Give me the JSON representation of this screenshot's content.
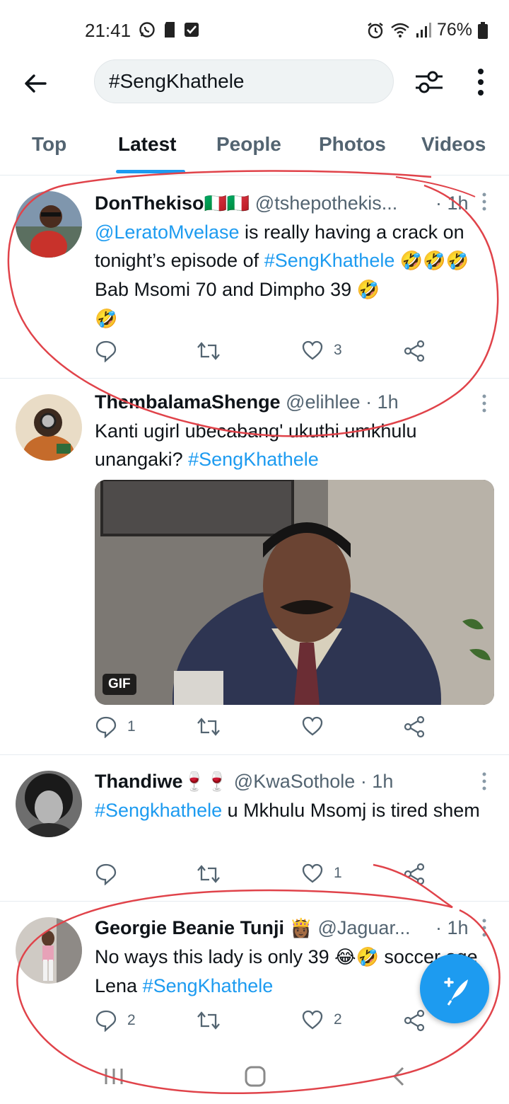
{
  "status_bar": {
    "time": "21:41",
    "battery": "76%"
  },
  "search": {
    "query": "#SengKhathele"
  },
  "tabs": [
    {
      "label": "Top"
    },
    {
      "label": "Latest",
      "active": true
    },
    {
      "label": "People"
    },
    {
      "label": "Photos"
    },
    {
      "label": "Videos"
    }
  ],
  "tweets": [
    {
      "name": "DonThekiso",
      "name_emoji": "🇮🇹🇮🇹",
      "handle": "@tshepothekis...",
      "time": "· 1h",
      "mention": "@LeratoMvelase",
      "text1": " is really having a crack on tonight’s episode of ",
      "hashtag": "#SengKhathele",
      "emoji1": "🤣🤣🤣",
      "text2": " Bab Msomi 70 and Dimpho 39 ",
      "emoji2": "🤣",
      "emoji3": "🤣",
      "replies": "",
      "retweets": "",
      "likes": "3"
    },
    {
      "name": "ThembalamaShenge",
      "handle": "@elihlee",
      "time": "· 1h",
      "text1": "Kanti ugirl ubecabang' ukuthi umkhulu unangaki? ",
      "hashtag": "#SengKhathele",
      "media_badge": "GIF",
      "replies": "1",
      "retweets": "",
      "likes": ""
    },
    {
      "name": "Thandiwe",
      "name_emoji": "🍷🍷",
      "handle": "@KwaSothole",
      "time": "· 1h",
      "hashtag": "#Sengkhathele",
      "text1": " u Mkhulu Msomj is tired shem",
      "replies": "",
      "retweets": "",
      "likes": "1"
    },
    {
      "name": "Georgie Beanie Tunji",
      "name_emoji": "👸🏾",
      "handle": "@Jaguar...",
      "time": "· 1h",
      "text1": "No ways this lady is only 39 ",
      "emoji1": "😂🤣",
      "text2": " soccer age Lena ",
      "hashtag": "#SengKhathele",
      "replies": "2",
      "retweets": "",
      "likes": "2"
    }
  ],
  "colors": {
    "accent": "#1d9bf0",
    "annotation": "#e0434a"
  }
}
